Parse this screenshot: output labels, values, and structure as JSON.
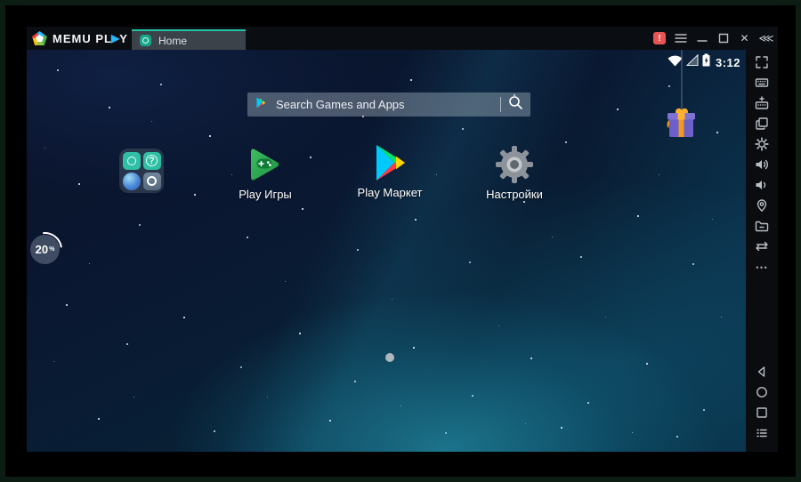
{
  "titlebar": {
    "logo": {
      "text_main": "MEMU PL",
      "play_glyph": "▶",
      "text_end": "Y"
    },
    "tab_home_label": "Home",
    "notification_glyph": "!",
    "close_glyph": "✕",
    "collapse_glyph": "⋘"
  },
  "status_bar": {
    "time": "3:12"
  },
  "home_screen": {
    "search": {
      "placeholder": "Search Games and Apps"
    },
    "apps": [
      {
        "label": "Play Игры"
      },
      {
        "label": "Play Маркет"
      },
      {
        "label": "Настройки"
      }
    ],
    "folder": {
      "mini_question_glyph": "?"
    },
    "progress_badge": {
      "value": "20",
      "unit": "%"
    }
  },
  "sidebar": {
    "more_glyph": "⋯"
  },
  "colors": {
    "accent_teal": "#23c3a2",
    "notification_red": "#e85454",
    "wallpaper_teal": "#0c4a5a"
  }
}
